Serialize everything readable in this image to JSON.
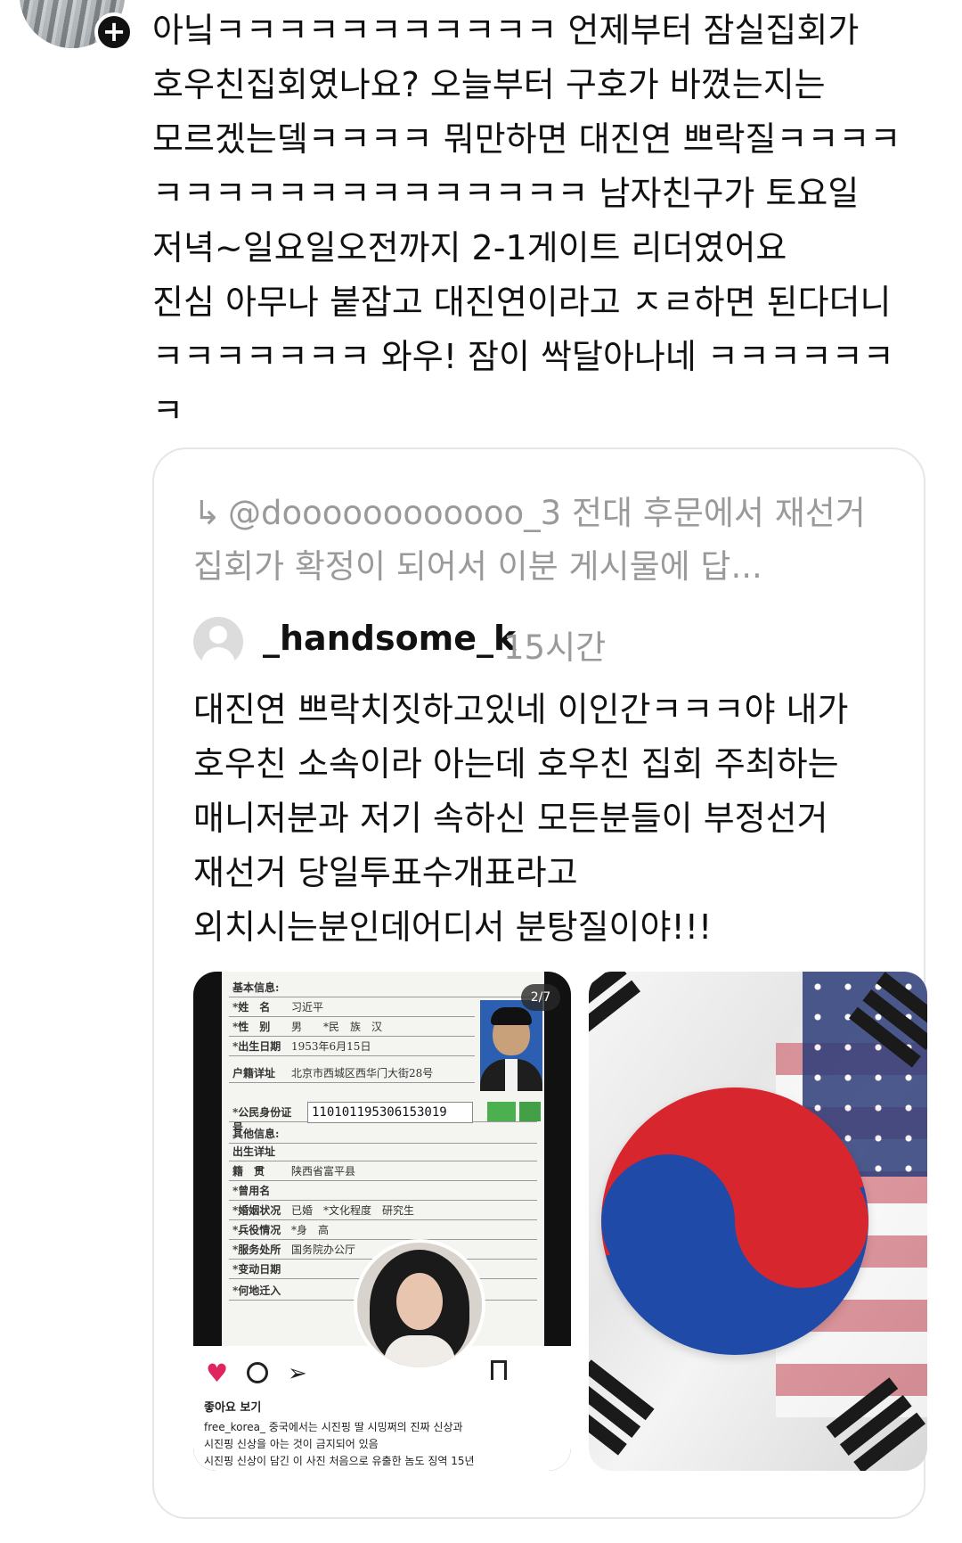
{
  "post": {
    "text": "아닠ㅋㅋㅋㅋㅋㅋㅋㅋㅋㅋㅋ 언제부터 잠실집회가\n호우친집회였나요? 오늘부터 구호가 바꼈는지는\n모르겠는뎈ㅋㅋㅋㅋ 뭐만하면 대진연 쁘락질ㅋㅋㅋㅋ\nㅋㅋㅋㅋㅋㅋㅋㅋㅋㅋㅋㅋㅋㅋ 남자친구가 토요일\n저녁~일요일오전까지 2-1게이트 리더였어요\n진심 아무나 붙잡고 대진연이라고 ㅈㄹ하면 된다더니\nㅋㅋㅋㅋㅋㅋㅋ 와우! 잠이 싹달아나네 ㅋㅋㅋㅋㅋㅋ\nㅋ"
  },
  "quote": {
    "reply_arrow": "↳",
    "reply_context": "@doooooooooooo_3 전대 후문에서 재선거 집회가 확정이 되어서 이분 게시물에 답...",
    "username": "_handsome_k",
    "time": "15시간",
    "text": "대진연 쁘락치짓하고있네 이인간ㅋㅋㅋ야 내가\n호우친 소속이라 아는데 호우친 집회 주최하는\n매니저분과 저기 속하신 모든분들이 부정선거\n재선거 당일투표수개표라고\n외치시는분인데어디서 분탕질이야!!!"
  },
  "media": {
    "image1": {
      "counter": "2/7",
      "doc_fields": [
        {
          "k": "基本信息:",
          "v": ""
        },
        {
          "k": "*姓　名",
          "v": "习近平"
        },
        {
          "k": "*性　别",
          "v": "男　　*民　族　汉"
        },
        {
          "k": "*出生日期",
          "v": "1953年6月15日"
        },
        {
          "k": "户籍详址",
          "v": "北京市西城区西华门大街28号"
        },
        {
          "k": "*公民身份证号",
          "v": ""
        },
        {
          "k": "其他信息:",
          "v": ""
        },
        {
          "k": "出生详址",
          "v": ""
        },
        {
          "k": "籍　贯",
          "v": "陕西省富平县"
        },
        {
          "k": "*曾用名",
          "v": ""
        },
        {
          "k": "*婚姻状况",
          "v": "已婚　*文化程度　研究生"
        },
        {
          "k": "*兵役情况",
          "v": "*身　高"
        },
        {
          "k": "*服务处所",
          "v": "国务院办公厅"
        },
        {
          "k": "*变动日期",
          "v": ""
        },
        {
          "k": "*何地迁入",
          "v": ""
        }
      ],
      "id_number": "110101195306153019",
      "likes_label": "좋아요 보기",
      "caption": "free_korea_ 중국에서는 시진핑 딸 시밍쩌의 진짜 신상과\n시진핑 신상을 아는 것이 금지되어 있음\n시진핑 신상이 담긴 이 사진 처음으로 유출한 놈도 징역 15년"
    },
    "image2": {}
  },
  "colors": {
    "secondary_text": "#9a9a9a",
    "heart": "#e0245e",
    "card_border": "#e6e6e6"
  }
}
